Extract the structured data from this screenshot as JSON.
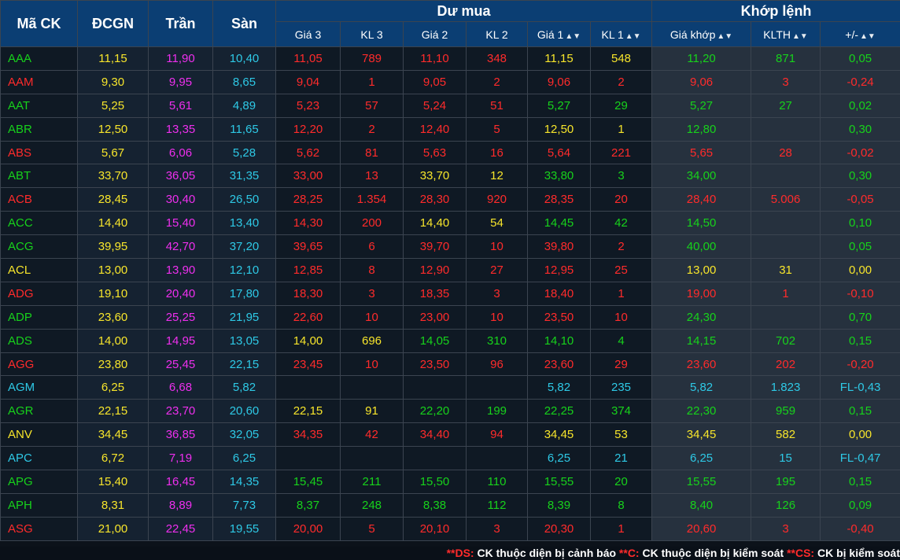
{
  "header": {
    "symbol": "Mã CK",
    "ref": "ĐCGN",
    "ceil": "Trần",
    "floor": "Sàn",
    "bid_group": "Dư mua",
    "match_group": "Khớp lệnh",
    "bid_cols": [
      "Giá 3",
      "KL 3",
      "Giá 2",
      "KL 2",
      "Giá 1",
      "KL 1"
    ],
    "match_cols": [
      "Giá khớp",
      "KLTH",
      "+/-"
    ]
  },
  "colors": {
    "header_bg": "#0b3e73",
    "up": "#17d21b",
    "down": "#ff2b2b",
    "reference": "#f7e52b",
    "ceiling": "#ee2fee",
    "floor": "#2ec9e6"
  },
  "rows": [
    {
      "sym": "AAA",
      "ref": "11,15",
      "ceil": "11,90",
      "floor": "10,40",
      "p3": "11,05",
      "v3": "789",
      "p2": "11,10",
      "v2": "348",
      "p1": "11,15",
      "v1": "548",
      "price": "11,20",
      "vol": "871",
      "chg": "0,05",
      "c": {
        "sym": "green",
        "p3": "red",
        "p2": "red",
        "p1": "yellow",
        "m": "green"
      }
    },
    {
      "sym": "AAM",
      "ref": "9,30",
      "ceil": "9,95",
      "floor": "8,65",
      "p3": "9,04",
      "v3": "1",
      "p2": "9,05",
      "v2": "2",
      "p1": "9,06",
      "v1": "2",
      "price": "9,06",
      "vol": "3",
      "chg": "-0,24",
      "c": {
        "sym": "red",
        "p3": "red",
        "p2": "red",
        "p1": "red",
        "m": "red"
      }
    },
    {
      "sym": "AAT",
      "ref": "5,25",
      "ceil": "5,61",
      "floor": "4,89",
      "p3": "5,23",
      "v3": "57",
      "p2": "5,24",
      "v2": "51",
      "p1": "5,27",
      "v1": "29",
      "price": "5,27",
      "vol": "27",
      "chg": "0,02",
      "c": {
        "sym": "green",
        "p3": "red",
        "p2": "red",
        "p1": "green",
        "m": "green"
      }
    },
    {
      "sym": "ABR",
      "ref": "12,50",
      "ceil": "13,35",
      "floor": "11,65",
      "p3": "12,20",
      "v3": "2",
      "p2": "12,40",
      "v2": "5",
      "p1": "12,50",
      "v1": "1",
      "price": "12,80",
      "vol": "",
      "chg": "0,30",
      "c": {
        "sym": "green",
        "p3": "red",
        "p2": "red",
        "p1": "yellow",
        "m": "green"
      }
    },
    {
      "sym": "ABS",
      "ref": "5,67",
      "ceil": "6,06",
      "floor": "5,28",
      "p3": "5,62",
      "v3": "81",
      "p2": "5,63",
      "v2": "16",
      "p1": "5,64",
      "v1": "221",
      "price": "5,65",
      "vol": "28",
      "chg": "-0,02",
      "c": {
        "sym": "red",
        "p3": "red",
        "p2": "red",
        "p1": "red",
        "m": "red"
      }
    },
    {
      "sym": "ABT",
      "ref": "33,70",
      "ceil": "36,05",
      "floor": "31,35",
      "p3": "33,00",
      "v3": "13",
      "p2": "33,70",
      "v2": "12",
      "p1": "33,80",
      "v1": "3",
      "price": "34,00",
      "vol": "",
      "chg": "0,30",
      "c": {
        "sym": "green",
        "p3": "red",
        "p2": "yellow",
        "p1": "green",
        "m": "green"
      }
    },
    {
      "sym": "ACB",
      "ref": "28,45",
      "ceil": "30,40",
      "floor": "26,50",
      "p3": "28,25",
      "v3": "1.354",
      "p2": "28,30",
      "v2": "920",
      "p1": "28,35",
      "v1": "20",
      "price": "28,40",
      "vol": "5.006",
      "chg": "-0,05",
      "c": {
        "sym": "red",
        "p3": "red",
        "p2": "red",
        "p1": "red",
        "m": "red"
      }
    },
    {
      "sym": "ACC",
      "ref": "14,40",
      "ceil": "15,40",
      "floor": "13,40",
      "p3": "14,30",
      "v3": "200",
      "p2": "14,40",
      "v2": "54",
      "p1": "14,45",
      "v1": "42",
      "price": "14,50",
      "vol": "",
      "chg": "0,10",
      "c": {
        "sym": "green",
        "p3": "red",
        "p2": "yellow",
        "p1": "green",
        "m": "green"
      }
    },
    {
      "sym": "ACG",
      "ref": "39,95",
      "ceil": "42,70",
      "floor": "37,20",
      "p3": "39,65",
      "v3": "6",
      "p2": "39,70",
      "v2": "10",
      "p1": "39,80",
      "v1": "2",
      "price": "40,00",
      "vol": "",
      "chg": "0,05",
      "c": {
        "sym": "green",
        "p3": "red",
        "p2": "red",
        "p1": "red",
        "m": "green"
      }
    },
    {
      "sym": "ACL",
      "ref": "13,00",
      "ceil": "13,90",
      "floor": "12,10",
      "p3": "12,85",
      "v3": "8",
      "p2": "12,90",
      "v2": "27",
      "p1": "12,95",
      "v1": "25",
      "price": "13,00",
      "vol": "31",
      "chg": "0,00",
      "c": {
        "sym": "yellow",
        "p3": "red",
        "p2": "red",
        "p1": "red",
        "m": "yellow"
      }
    },
    {
      "sym": "ADG",
      "ref": "19,10",
      "ceil": "20,40",
      "floor": "17,80",
      "p3": "18,30",
      "v3": "3",
      "p2": "18,35",
      "v2": "3",
      "p1": "18,40",
      "v1": "1",
      "price": "19,00",
      "vol": "1",
      "chg": "-0,10",
      "c": {
        "sym": "red",
        "p3": "red",
        "p2": "red",
        "p1": "red",
        "m": "red"
      }
    },
    {
      "sym": "ADP",
      "ref": "23,60",
      "ceil": "25,25",
      "floor": "21,95",
      "p3": "22,60",
      "v3": "10",
      "p2": "23,00",
      "v2": "10",
      "p1": "23,50",
      "v1": "10",
      "price": "24,30",
      "vol": "",
      "chg": "0,70",
      "c": {
        "sym": "green",
        "p3": "red",
        "p2": "red",
        "p1": "red",
        "m": "green"
      }
    },
    {
      "sym": "ADS",
      "ref": "14,00",
      "ceil": "14,95",
      "floor": "13,05",
      "p3": "14,00",
      "v3": "696",
      "p2": "14,05",
      "v2": "310",
      "p1": "14,10",
      "v1": "4",
      "price": "14,15",
      "vol": "702",
      "chg": "0,15",
      "c": {
        "sym": "green",
        "p3": "yellow",
        "p2": "green",
        "p1": "green",
        "m": "green"
      }
    },
    {
      "sym": "AGG",
      "ref": "23,80",
      "ceil": "25,45",
      "floor": "22,15",
      "p3": "23,45",
      "v3": "10",
      "p2": "23,50",
      "v2": "96",
      "p1": "23,60",
      "v1": "29",
      "price": "23,60",
      "vol": "202",
      "chg": "-0,20",
      "c": {
        "sym": "red",
        "p3": "red",
        "p2": "red",
        "p1": "red",
        "m": "red"
      }
    },
    {
      "sym": "AGM",
      "ref": "6,25",
      "ceil": "6,68",
      "floor": "5,82",
      "p3": "",
      "v3": "",
      "p2": "",
      "v2": "",
      "p1": "5,82",
      "v1": "235",
      "price": "5,82",
      "vol": "1.823",
      "chg": "FL-0,43",
      "c": {
        "sym": "cyan",
        "p3": "white",
        "p2": "white",
        "p1": "cyan",
        "m": "cyan"
      }
    },
    {
      "sym": "AGR",
      "ref": "22,15",
      "ceil": "23,70",
      "floor": "20,60",
      "p3": "22,15",
      "v3": "91",
      "p2": "22,20",
      "v2": "199",
      "p1": "22,25",
      "v1": "374",
      "price": "22,30",
      "vol": "959",
      "chg": "0,15",
      "c": {
        "sym": "green",
        "p3": "yellow",
        "p2": "green",
        "p1": "green",
        "m": "green"
      }
    },
    {
      "sym": "ANV",
      "ref": "34,45",
      "ceil": "36,85",
      "floor": "32,05",
      "p3": "34,35",
      "v3": "42",
      "p2": "34,40",
      "v2": "94",
      "p1": "34,45",
      "v1": "53",
      "price": "34,45",
      "vol": "582",
      "chg": "0,00",
      "c": {
        "sym": "yellow",
        "p3": "red",
        "p2": "red",
        "p1": "yellow",
        "m": "yellow"
      }
    },
    {
      "sym": "APC",
      "ref": "6,72",
      "ceil": "7,19",
      "floor": "6,25",
      "p3": "",
      "v3": "",
      "p2": "",
      "v2": "",
      "p1": "6,25",
      "v1": "21",
      "price": "6,25",
      "vol": "15",
      "chg": "FL-0,47",
      "c": {
        "sym": "cyan",
        "p3": "white",
        "p2": "white",
        "p1": "cyan",
        "m": "cyan"
      }
    },
    {
      "sym": "APG",
      "ref": "15,40",
      "ceil": "16,45",
      "floor": "14,35",
      "p3": "15,45",
      "v3": "211",
      "p2": "15,50",
      "v2": "110",
      "p1": "15,55",
      "v1": "20",
      "price": "15,55",
      "vol": "195",
      "chg": "0,15",
      "c": {
        "sym": "green",
        "p3": "green",
        "p2": "green",
        "p1": "green",
        "m": "green"
      }
    },
    {
      "sym": "APH",
      "ref": "8,31",
      "ceil": "8,89",
      "floor": "7,73",
      "p3": "8,37",
      "v3": "248",
      "p2": "8,38",
      "v2": "112",
      "p1": "8,39",
      "v1": "8",
      "price": "8,40",
      "vol": "126",
      "chg": "0,09",
      "c": {
        "sym": "green",
        "p3": "green",
        "p2": "green",
        "p1": "green",
        "m": "green"
      }
    },
    {
      "sym": "ASG",
      "ref": "21,00",
      "ceil": "22,45",
      "floor": "19,55",
      "p3": "20,00",
      "v3": "5",
      "p2": "20,10",
      "v2": "3",
      "p1": "20,30",
      "v1": "1",
      "price": "20,60",
      "vol": "3",
      "chg": "-0,40",
      "c": {
        "sym": "red",
        "p3": "red",
        "p2": "red",
        "p1": "red",
        "m": "red"
      }
    }
  ],
  "legend": [
    {
      "code": "**DS:",
      "text": " CK thuộc diện bị cảnh báo "
    },
    {
      "code": "**C:",
      "text": " CK thuộc diện bị kiểm soát "
    },
    {
      "code": "**CS:",
      "text": " CK bị kiểm soát"
    }
  ]
}
